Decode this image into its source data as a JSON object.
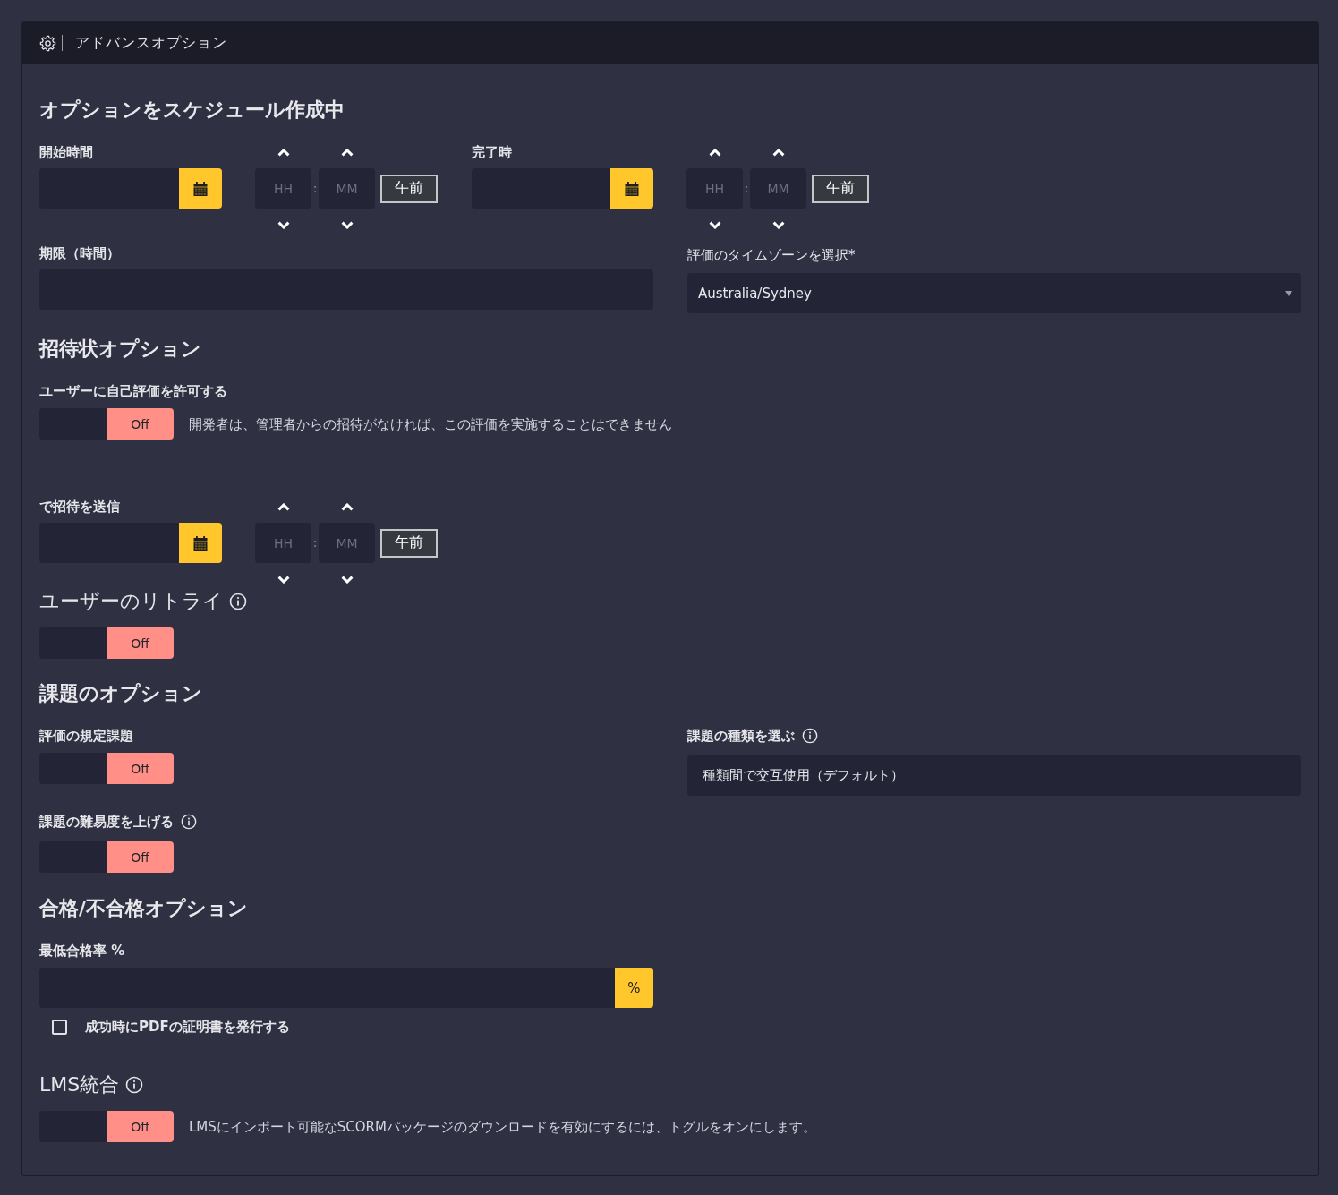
{
  "panel": {
    "title": "アドバンスオプション"
  },
  "scheduling": {
    "heading": "オプションをスケジュール作成中",
    "start": {
      "label": "開始時間",
      "time": {
        "hour_placeholder": "HH",
        "separator": ":",
        "minute_placeholder": "MM",
        "meridiem": "午前"
      }
    },
    "end": {
      "label": "完了時",
      "time": {
        "hour_placeholder": "HH",
        "separator": ":",
        "minute_placeholder": "MM",
        "meridiem": "午前"
      }
    },
    "deadline": {
      "label": "期限（時間）"
    },
    "timezone": {
      "label": "評価のタイムゾーンを選択*",
      "value": "Australia/Sydney"
    }
  },
  "invitation": {
    "heading": "招待状オプション",
    "self_assessment": {
      "label": "ユーザーに自己評価を許可する",
      "toggle": {
        "on": false,
        "text": "Off"
      },
      "description": "開発者は、管理者からの招待がなければ、この評価を実施することはできません"
    },
    "send_invite": {
      "label": "で招待を送信",
      "time": {
        "hour_placeholder": "HH",
        "separator": ":",
        "minute_placeholder": "MM",
        "meridiem": "午前"
      }
    },
    "retries": {
      "label": "ユーザーのリトライ",
      "toggle": {
        "on": false,
        "text": "Off"
      }
    }
  },
  "challenges": {
    "heading": "課題のオプション",
    "prescribed": {
      "label": "評価の規定課題",
      "toggle": {
        "on": false,
        "text": "Off"
      }
    },
    "difficulty": {
      "label": "課題の難易度を上げる",
      "toggle": {
        "on": false,
        "text": "Off"
      }
    },
    "type": {
      "label": "課題の種類を選ぶ",
      "value": "種類間で交互使用（デフォルト）"
    }
  },
  "pass_fail": {
    "heading": "合格/不合格オプション",
    "min_score": {
      "label": "最低合格率 %",
      "unit": "%"
    },
    "certificate": {
      "label": "成功時にPDFの証明書を発行する",
      "checked": false
    }
  },
  "lms": {
    "label": "LMS統合",
    "toggle": {
      "on": false,
      "text": "Off"
    },
    "description": "LMSにインポート可能なSCORMパッケージのダウンロードを有効にするには、トグルをオンにします。"
  }
}
